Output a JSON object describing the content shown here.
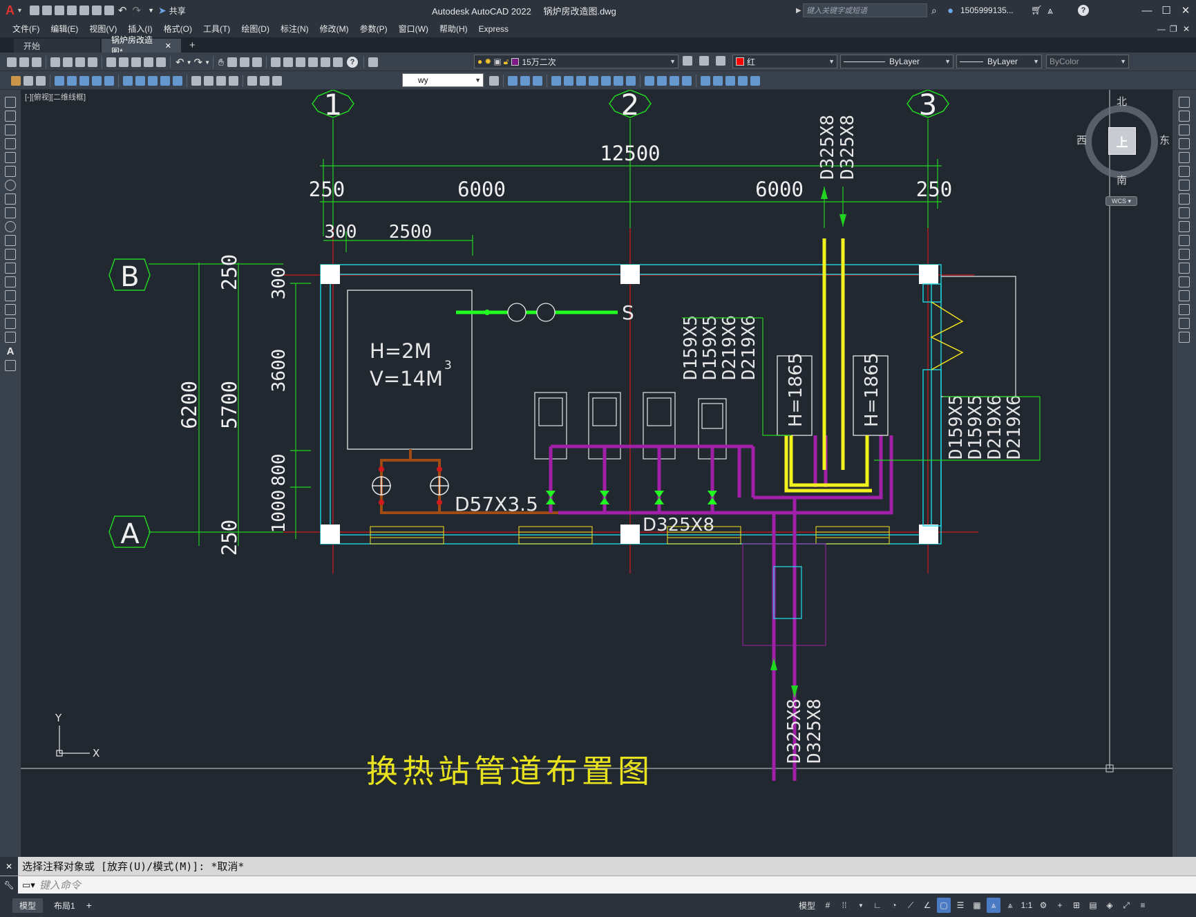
{
  "app": {
    "title": "Autodesk AutoCAD 2022",
    "filename": "锅炉房改造图.dwg",
    "share_label": "共享",
    "search_placeholder": "键入关键字或短语",
    "user": "1505999135...",
    "logo": "A"
  },
  "menu": [
    "文件(F)",
    "编辑(E)",
    "视图(V)",
    "插入(I)",
    "格式(O)",
    "工具(T)",
    "绘图(D)",
    "标注(N)",
    "修改(M)",
    "参数(P)",
    "窗口(W)",
    "帮助(H)",
    "Express"
  ],
  "tabs": {
    "start": "开始",
    "active": "锅炉房改造图*"
  },
  "properties": {
    "layer": "15万二次",
    "color": "红",
    "linetype": "ByLayer",
    "lineweight": "ByLayer",
    "plotstyle": "ByColor",
    "text_style": "wy"
  },
  "viewport": {
    "label": "[-][俯视][二维线框]"
  },
  "viewcube": {
    "north": "北",
    "south": "南",
    "east": "东",
    "west": "西",
    "top": "上",
    "wcs": "WCS"
  },
  "ucs": {
    "x": "X",
    "y": "Y"
  },
  "drawing": {
    "grid_cols": [
      "1",
      "2",
      "3"
    ],
    "grid_rows": [
      "B",
      "A"
    ],
    "dims_top": [
      "12500",
      "250",
      "6000",
      "6000",
      "250",
      "300",
      "2500"
    ],
    "dims_left": [
      "250",
      "300",
      "3600",
      "6200",
      "5700",
      "800",
      "1000",
      "250"
    ],
    "tank_label_h": "H=2M",
    "tank_label_v": "V=14M",
    "tank_label_sup": "3",
    "pipe_d57": "D57X3.5",
    "pipe_d325": "D325X8",
    "pipe_d325_top_a": "D325X8",
    "pipe_d325_top_b": "D325X8",
    "pipe_d325_bot_a": "D325X8",
    "pipe_d325_bot_b": "D325X8",
    "pipe_group_mid": [
      "D159X5",
      "D159X5",
      "D219X6",
      "D219X6"
    ],
    "pipe_group_right": [
      "D159X5",
      "D159X5",
      "D219X6",
      "D219X6"
    ],
    "hx_label_1": "H=1865",
    "hx_label_2": "H=1865",
    "s_label": "S",
    "drawing_title": "换热站管道布置图"
  },
  "command": {
    "history": "选择注释对象或 [放弃(U)/模式(M)]: *取消*",
    "placeholder": "键入命令"
  },
  "status": {
    "model": "模型",
    "model_tab": "模型",
    "layout_tab": "布局1",
    "scale": "1:1"
  }
}
